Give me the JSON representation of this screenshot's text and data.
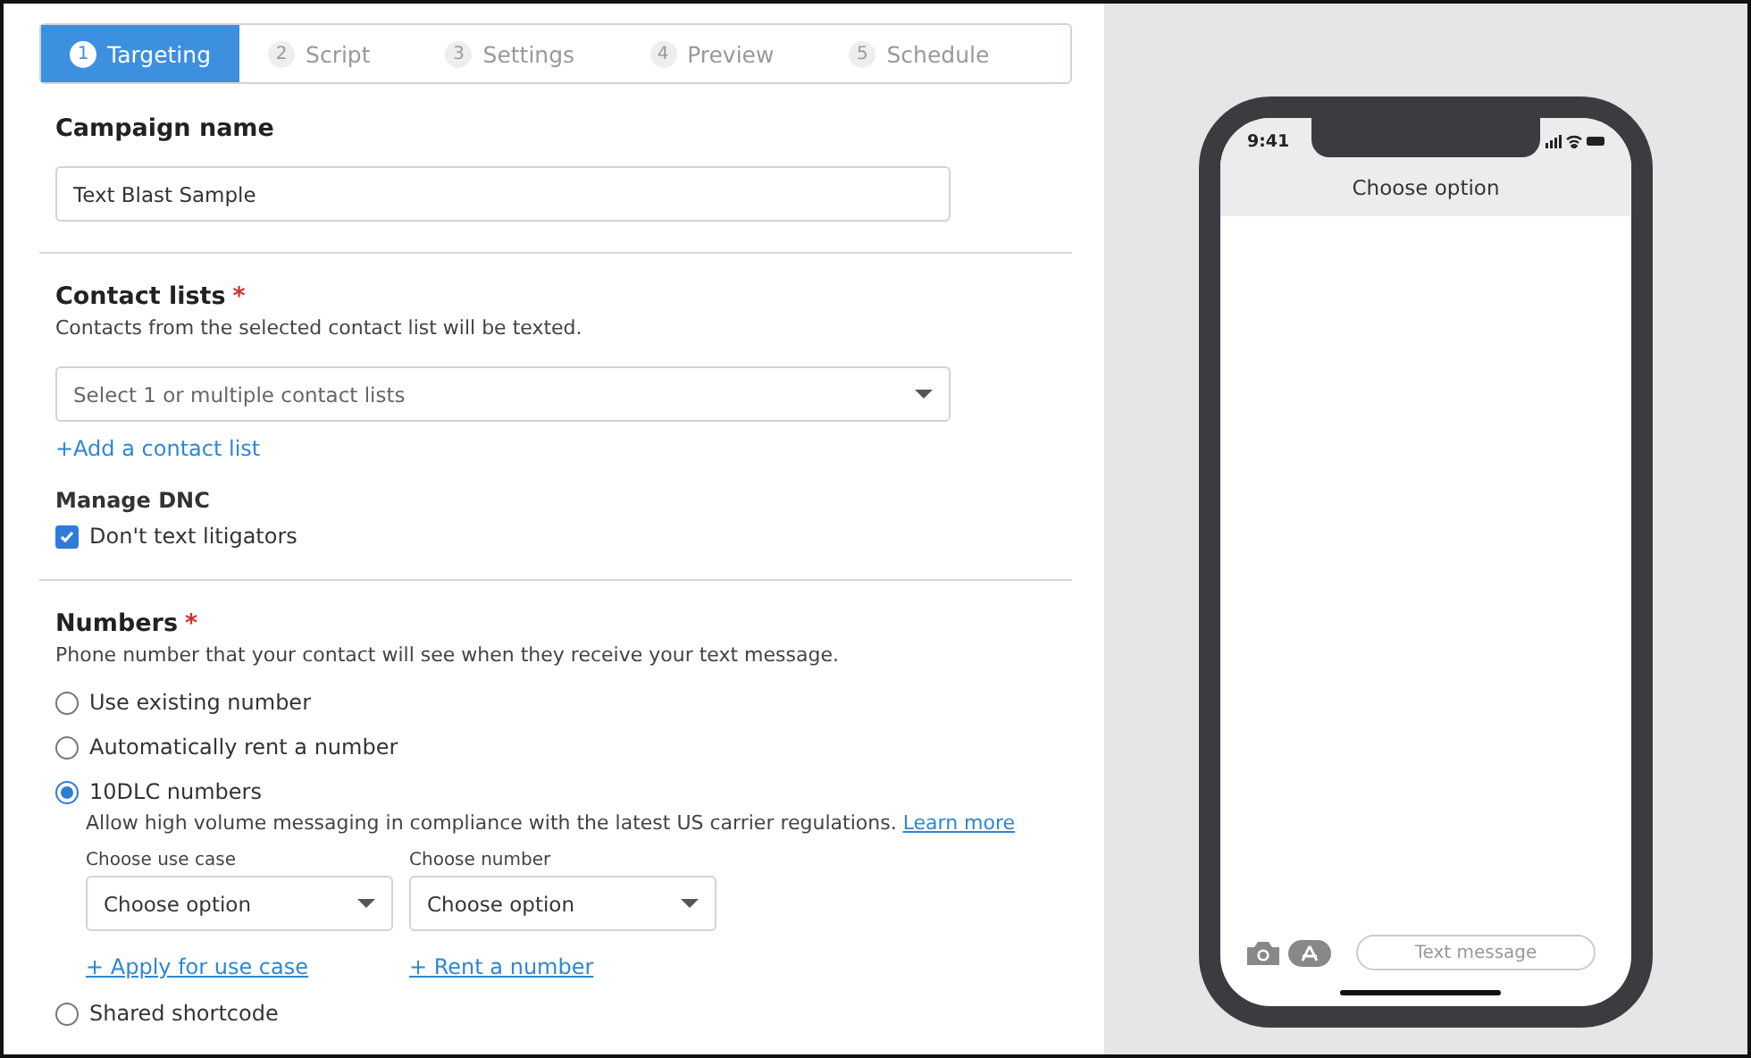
{
  "steps": [
    {
      "number": "1",
      "label": "Targeting",
      "selected": true
    },
    {
      "number": "2",
      "label": "Script",
      "selected": false
    },
    {
      "number": "3",
      "label": "Settings",
      "selected": false
    },
    {
      "number": "4",
      "label": "Preview",
      "selected": false
    },
    {
      "number": "5",
      "label": "Schedule",
      "selected": false
    }
  ],
  "campaign": {
    "title": "Campaign name",
    "value": "Text Blast Sample"
  },
  "contact_lists": {
    "title": "Contact lists",
    "required_mark": "*",
    "description": "Contacts from the selected contact list will be texted.",
    "placeholder": "Select 1 or multiple contact lists",
    "add_link": "+Add a contact list"
  },
  "dnc": {
    "title": "Manage DNC",
    "options": [
      {
        "label": "Don't text litigators",
        "checked": true
      }
    ]
  },
  "numbers": {
    "title": "Numbers",
    "required_mark": "*",
    "description": "Phone number that your contact will see when they receive your text message.",
    "options": [
      {
        "label": "Use existing number",
        "selected": false
      },
      {
        "label": "Automatically rent a number",
        "selected": false
      },
      {
        "label": "10DLC numbers",
        "selected": true,
        "description": "Allow high volume messaging in compliance with the latest US carrier regulations.",
        "link": "Learn more",
        "selects": [
          {
            "label": "Choose use case",
            "value": "Choose option",
            "link": "+ Apply for use case"
          },
          {
            "label": "Choose number",
            "value": "Choose option",
            "link": "+ Rent a number"
          }
        ]
      },
      {
        "label": "Shared shortcode",
        "selected": false
      }
    ]
  },
  "phone": {
    "time": "9:41",
    "header": "Choose option",
    "message_placeholder": "Text message"
  }
}
